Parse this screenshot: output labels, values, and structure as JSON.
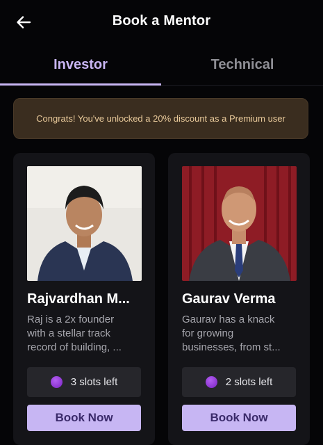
{
  "header": {
    "title": "Book a Mentor",
    "back_icon": "arrow-left-icon"
  },
  "tabs": [
    {
      "label": "Investor",
      "active": true
    },
    {
      "label": "Technical",
      "active": false
    }
  ],
  "banner": {
    "text": "Congrats! You've unlocked a 20% discount as a Premium user"
  },
  "mentors": [
    {
      "name": "Rajvardhan M...",
      "description_lines": [
        "Raj is a 2x founder",
        "with a stellar track",
        "record of building, ..."
      ],
      "slots": "3 slots left",
      "book_label": "Book Now"
    },
    {
      "name": "Gaurav Verma",
      "description_lines": [
        "Gaurav has a knack",
        "for growing",
        "businesses, from st..."
      ],
      "slots": "2 slots left",
      "book_label": "Book Now"
    }
  ],
  "colors": {
    "accent": "#c9b6f4",
    "banner_bg": "#3a2d1f",
    "banner_text": "#e8c99a",
    "slot_dot": "#9a3fe0"
  }
}
